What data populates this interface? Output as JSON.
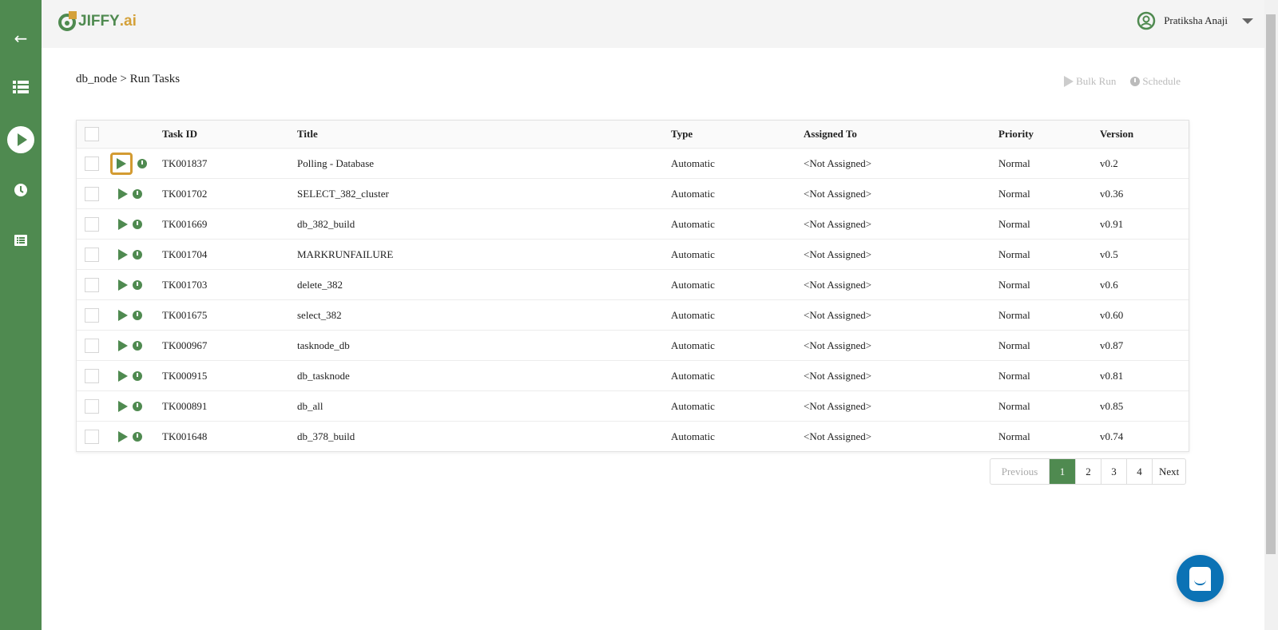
{
  "app": {
    "logo": "JIFFY",
    "logo_suffix": ".ai",
    "user_name": "Pratiksha Anaji"
  },
  "breadcrumb": "db_node > Run Tasks",
  "actions": {
    "bulk_run": "Bulk Run",
    "schedule": "Schedule"
  },
  "columns": {
    "task_id": "Task ID",
    "title": "Title",
    "type": "Type",
    "assigned": "Assigned To",
    "priority": "Priority",
    "version": "Version"
  },
  "rows": [
    {
      "id": "TK001837",
      "title": "Polling - Database",
      "type": "Automatic",
      "assigned": "<Not Assigned>",
      "priority": "Normal",
      "version": "v0.2"
    },
    {
      "id": "TK001702",
      "title": "SELECT_382_cluster",
      "type": "Automatic",
      "assigned": "<Not Assigned>",
      "priority": "Normal",
      "version": "v0.36"
    },
    {
      "id": "TK001669",
      "title": "db_382_build",
      "type": "Automatic",
      "assigned": "<Not Assigned>",
      "priority": "Normal",
      "version": "v0.91"
    },
    {
      "id": "TK001704",
      "title": "MARKRUNFAILURE",
      "type": "Automatic",
      "assigned": "<Not Assigned>",
      "priority": "Normal",
      "version": "v0.5"
    },
    {
      "id": "TK001703",
      "title": "delete_382",
      "type": "Automatic",
      "assigned": "<Not Assigned>",
      "priority": "Normal",
      "version": "v0.6"
    },
    {
      "id": "TK001675",
      "title": "select_382",
      "type": "Automatic",
      "assigned": "<Not Assigned>",
      "priority": "Normal",
      "version": "v0.60"
    },
    {
      "id": "TK000967",
      "title": "tasknode_db",
      "type": "Automatic",
      "assigned": "<Not Assigned>",
      "priority": "Normal",
      "version": "v0.87"
    },
    {
      "id": "TK000915",
      "title": "db_tasknode",
      "type": "Automatic",
      "assigned": "<Not Assigned>",
      "priority": "Normal",
      "version": "v0.81"
    },
    {
      "id": "TK000891",
      "title": "db_all",
      "type": "Automatic",
      "assigned": "<Not Assigned>",
      "priority": "Normal",
      "version": "v0.85"
    },
    {
      "id": "TK001648",
      "title": "db_378_build",
      "type": "Automatic",
      "assigned": "<Not Assigned>",
      "priority": "Normal",
      "version": "v0.74"
    }
  ],
  "pagination": {
    "previous": "Previous",
    "pages": [
      "1",
      "2",
      "3",
      "4"
    ],
    "next": "Next",
    "current": "1"
  }
}
